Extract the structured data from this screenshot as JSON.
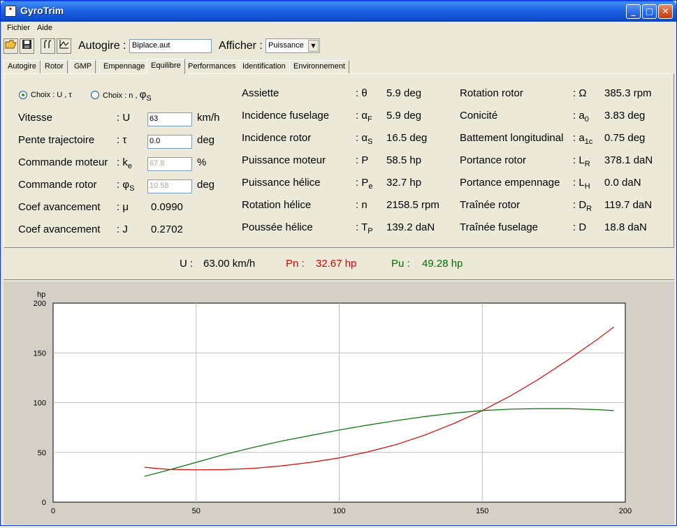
{
  "window": {
    "title": "GyroTrim",
    "app_icon_text": "Gyro\nTrim"
  },
  "menu": [
    "Fichier",
    "Aide"
  ],
  "toolbar": {
    "autogire_label": "Autogire :",
    "autogire_value": "Biplace.aut",
    "afficher_label": "Afficher :",
    "afficher_value": "Puissance"
  },
  "tabs": [
    "Autogire",
    "Rotor",
    "GMP",
    "Empennage",
    "Equilibre",
    "Performances",
    "Identification",
    "Environnement"
  ],
  "active_tab": "Equilibre",
  "choices": {
    "choice1": "Choix : U , τ",
    "choice2": "Choix : n , ",
    "choice2_sym": "φ",
    "choice2_sub": "S",
    "selected": "choice1"
  },
  "inputs": [
    {
      "label": "Vitesse",
      "sym": ": U",
      "sub": "",
      "value": "63",
      "unit": "km/h",
      "enabled": true
    },
    {
      "label": "Pente trajectoire",
      "sym": ": τ",
      "sub": "",
      "value": "0.0",
      "unit": "deg",
      "enabled": true
    },
    {
      "label": "Commande moteur",
      "sym": ": k",
      "sub": "e",
      "value": "67.8",
      "unit": "%",
      "enabled": false
    },
    {
      "label": "Commande rotor",
      "sym": ": φ",
      "sub": "S",
      "value": "10.58",
      "unit": "deg",
      "enabled": false
    },
    {
      "label": "Coef avancement",
      "sym": ": μ",
      "sub": "",
      "value": "0.0990",
      "unit": "",
      "enabled": false
    },
    {
      "label": "Coef avancement",
      "sym": ": J",
      "sub": "",
      "value": "0.2702",
      "unit": "",
      "enabled": false
    }
  ],
  "col2": [
    {
      "label": "Assiette",
      "sym": ": θ",
      "sub": "",
      "value": "5.9 deg"
    },
    {
      "label": "Incidence fuselage",
      "sym": ": α",
      "sub": "F",
      "value": "5.9 deg"
    },
    {
      "label": "Incidence rotor",
      "sym": ": α",
      "sub": "S",
      "value": "16.5 deg"
    },
    {
      "label": "Puissance moteur",
      "sym": ": P",
      "sub": "",
      "value": "58.5 hp"
    },
    {
      "label": "Puissance hélice",
      "sym": ": P",
      "sub": "e",
      "value": "32.7 hp"
    },
    {
      "label": "Rotation hélice",
      "sym": ": n",
      "sub": "",
      "value": "2158.5 rpm"
    },
    {
      "label": "Poussée hélice",
      "sym": ": T",
      "sub": "P",
      "value": "139.2 daN"
    }
  ],
  "col3": [
    {
      "label": "Rotation  rotor",
      "sym": ": Ω",
      "sub": "",
      "value": "385.3 rpm"
    },
    {
      "label": "Conicité",
      "sym": ": a",
      "sub": "0",
      "value": "3.83 deg"
    },
    {
      "label": "Battement longitudinal",
      "sym": ": a",
      "sub": "1c",
      "value": "0.75 deg"
    },
    {
      "label": "Portance rotor",
      "sym": ": L",
      "sub": "R",
      "value": "378.1 daN"
    },
    {
      "label": "Portance empennage",
      "sym": ": L",
      "sub": "H",
      "value": "0.0 daN"
    },
    {
      "label": "Traînée rotor",
      "sym": ": D",
      "sub": "R",
      "value": "119.7 daN"
    },
    {
      "label": "Traînée fuselage",
      "sym": ": D",
      "sub": "",
      "value": "18.8 daN"
    }
  ],
  "summary": {
    "u_label": "U :",
    "u_value": "63.00 km/h",
    "pn_label": "Pn :",
    "pn_value": "32.67 hp",
    "pu_label": "Pu :",
    "pu_value": "49.28 hp",
    "pn_color": "#e00000",
    "pu_color": "#007000"
  },
  "chart_data": {
    "type": "line",
    "ylabel": "hp",
    "xlabel": "",
    "xlim": [
      0,
      200
    ],
    "ylim": [
      0,
      200
    ],
    "xticks": [
      0,
      50,
      100,
      150,
      200
    ],
    "yticks": [
      0,
      50,
      100,
      150,
      200
    ],
    "grid": true,
    "series": [
      {
        "color": "#e00000",
        "x": [
          32,
          40,
          50,
          60,
          70,
          80,
          90,
          100,
          110,
          120,
          130,
          140,
          150,
          160,
          170,
          180,
          190,
          196
        ],
        "values": [
          35,
          33,
          32.5,
          32.7,
          34,
          36.5,
          40,
          44.5,
          50.5,
          58,
          67.5,
          79,
          92,
          107,
          124,
          143,
          163,
          176
        ]
      },
      {
        "color": "#007000",
        "x": [
          32,
          40,
          50,
          60,
          70,
          80,
          90,
          100,
          110,
          120,
          130,
          140,
          150,
          160,
          170,
          180,
          190,
          196
        ],
        "values": [
          26,
          32,
          40,
          48,
          55,
          61.5,
          67,
          72.5,
          77.5,
          82,
          86,
          89.5,
          92,
          93.5,
          94,
          94,
          93,
          92
        ]
      }
    ]
  }
}
